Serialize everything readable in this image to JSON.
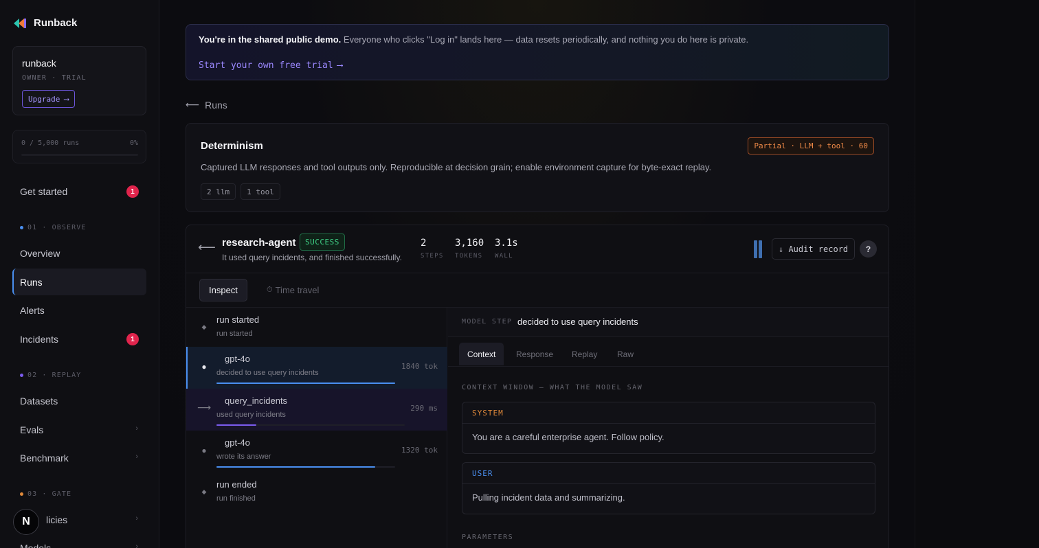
{
  "brand": {
    "name": "Runback"
  },
  "org": {
    "name": "runback",
    "role": "OWNER · TRIAL",
    "upgrade_label": "Upgrade",
    "upgrade_arrow": "⟶"
  },
  "usage": {
    "text": "0 / 5,000 runs",
    "percent": "0%",
    "fill_fraction": 0
  },
  "nav": {
    "get_started": {
      "label": "Get started",
      "badge": "1"
    },
    "observe_section": "01 · OBSERVE",
    "overview": "Overview",
    "runs": "Runs",
    "alerts": "Alerts",
    "incidents": {
      "label": "Incidents",
      "badge": "1"
    },
    "replay_section": "02 · REPLAY",
    "datasets": "Datasets",
    "evals": "Evals",
    "benchmark": "Benchmark",
    "gate_section": "03 · GATE",
    "policies": "licies",
    "models": "Models",
    "chevron": "›"
  },
  "avatar": {
    "letter": "N"
  },
  "banner": {
    "bold": "You're in the shared public demo.",
    "text": " Everyone who clicks \"Log in\" lands here — data resets periodically, and nothing you do here is private.",
    "cta": "Start your own free trial",
    "cta_arrow": "⟶"
  },
  "back": {
    "arrow": "⟵",
    "label": "Runs"
  },
  "determinism": {
    "title": "Determinism",
    "description": "Captured LLM responses and tool outputs only. Reproducible at decision grain; enable environment capture for byte-exact replay.",
    "chips": [
      "2 llm",
      "1 tool"
    ],
    "badge": "Partial · LLM + tool · 60"
  },
  "run": {
    "back_arrow": "⟵",
    "name": "research-agent",
    "status": "SUCCESS",
    "summary": "It used query incidents, and finished successfully.",
    "stats": [
      {
        "value": "2",
        "label": "STEPS"
      },
      {
        "value": "3,160",
        "label": "TOKENS"
      },
      {
        "value": "3.1s",
        "label": "WALL"
      }
    ],
    "audit_label": "↓ Audit record",
    "help": "?"
  },
  "mode_tabs": {
    "inspect": "Inspect",
    "time_travel_icon": "⏱",
    "time_travel": "Time travel"
  },
  "steps": [
    {
      "marker": "◆",
      "title": "run started",
      "desc": "run started",
      "meta": "",
      "progress": null,
      "color": ""
    },
    {
      "marker": "●",
      "title": "gpt-4o",
      "desc": "decided to use query incidents",
      "meta": "1840 tok",
      "progress": 1.0,
      "color": "#4a8ff0"
    },
    {
      "marker": "⟶",
      "title": "query_incidents",
      "desc": "used query incidents",
      "meta": "290 ms",
      "progress": 0.21,
      "color": "#7c5cf0"
    },
    {
      "marker": "●",
      "title": "gpt-4o",
      "desc": "wrote its answer",
      "meta": "1320 tok",
      "progress": 0.89,
      "color": "#4a8ff0"
    },
    {
      "marker": "◆",
      "title": "run ended",
      "desc": "run finished",
      "meta": "",
      "progress": null,
      "color": ""
    }
  ],
  "detail": {
    "kind": "MODEL STEP",
    "summary": "decided to use query incidents",
    "tabs": [
      "Context",
      "Response",
      "Replay",
      "Raw"
    ],
    "context_label": "CONTEXT WINDOW — WHAT THE MODEL SAW",
    "messages": [
      {
        "role": "SYSTEM",
        "color": "#e0893a",
        "text": "You are a careful enterprise agent. Follow policy."
      },
      {
        "role": "USER",
        "color": "#4a8ff0",
        "text": "Pulling incident data and summarizing."
      }
    ],
    "parameters_label": "PARAMETERS"
  },
  "colors": {
    "accent": "#4a8ff0",
    "violet": "#9b88ff",
    "danger": "#e0244c",
    "success": "#3fcf85",
    "warn": "#f08a48"
  }
}
